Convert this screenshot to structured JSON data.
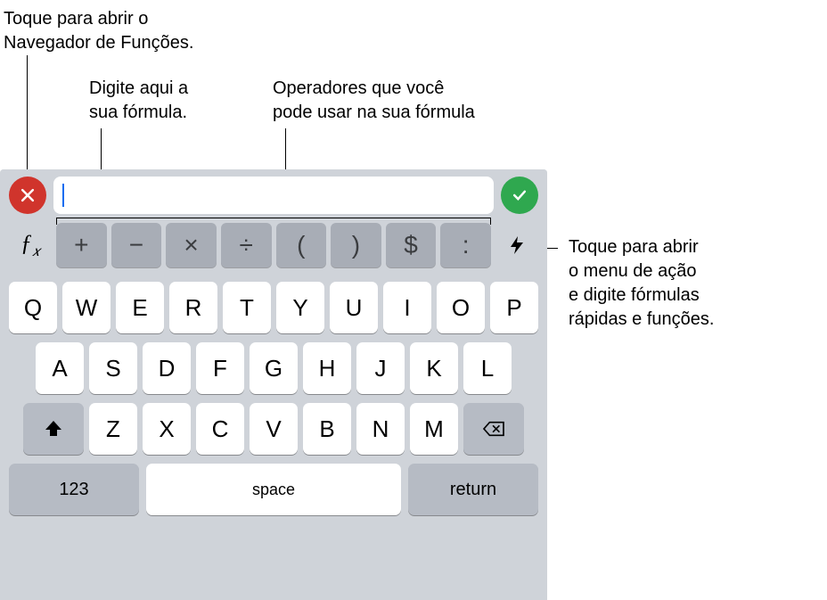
{
  "callouts": {
    "fx": "Toque para abrir o\nNavegador de Funções.",
    "formula": "Digite aqui a\nsua fórmula.",
    "operators": "Operadores que você\npode usar na sua fórmula",
    "bolt": "Toque para abrir\no menu de ação\ne digite fórmulas\nrápidas e funções."
  },
  "formula_bar": {
    "cancel_icon": "x",
    "confirm_icon": "check",
    "input_value": ""
  },
  "fx_label": "ƒx",
  "bolt_icon": "bolt",
  "operators": [
    "+",
    "−",
    "×",
    "÷",
    "(",
    ")",
    "$",
    ":"
  ],
  "keyboard": {
    "row1": [
      "Q",
      "W",
      "E",
      "R",
      "T",
      "Y",
      "U",
      "I",
      "O",
      "P"
    ],
    "row2": [
      "A",
      "S",
      "D",
      "F",
      "G",
      "H",
      "J",
      "K",
      "L"
    ],
    "row3_letters": [
      "Z",
      "X",
      "C",
      "V",
      "B",
      "N",
      "M"
    ],
    "shift_icon": "shift",
    "backspace_icon": "backspace",
    "numbers_label": "123",
    "space_label": "space",
    "return_label": "return"
  }
}
